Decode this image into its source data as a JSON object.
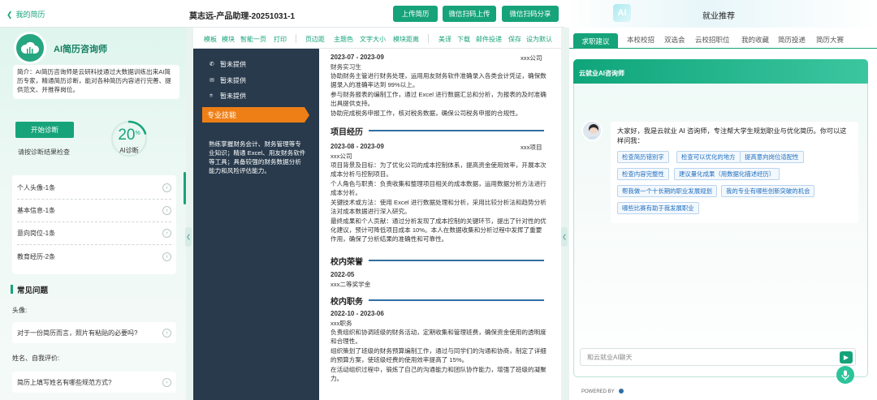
{
  "header": {
    "back_label": "我的简历",
    "doc_title": "莫志远-产品助理-20251031-1",
    "buttons": [
      "上传简历",
      "微信扫码上传",
      "微信扫码分享"
    ],
    "ai_logo": "AI",
    "reco_title": "就业推荐"
  },
  "left": {
    "advisor_title": "AI简历咨询师",
    "intro": "简介：AI简历咨询师是云研科技通过大数据训练出来AI简历专家，精通简历诊断，能对各种简历内容进行完善、提供范文、并推荐岗位。",
    "diagnose_button": "开始诊断",
    "hint": "请按诊断结果检查",
    "score": "20",
    "score_unit": "%",
    "score_label": "AI诊断",
    "score_percent": 20,
    "sections": [
      {
        "label": "个人头像-1条"
      },
      {
        "label": "基本信息-1条"
      },
      {
        "label": "意向岗位-1条"
      },
      {
        "label": "教育经历-2条"
      }
    ],
    "faq_title": "常见问题",
    "faq": [
      {
        "category": "头像:",
        "question": "对于一份简历而言，照片有粘贴的必要吗?"
      },
      {
        "category": "姓名、自我评价:",
        "question": "简历上填写姓名有哪些规范方式?"
      }
    ]
  },
  "toolbar": {
    "group1": [
      "模板",
      "模块",
      "智能一页",
      "打印"
    ],
    "group2": [
      "页边距",
      "主题色",
      "文字大小",
      "模块距离"
    ],
    "group3": [
      "美译",
      "下载",
      "邮件投递",
      "保存",
      "设为默认"
    ]
  },
  "resume": {
    "contact": [
      "暂未提供",
      "暂未提供",
      "暂未提供"
    ],
    "skills_title": "专业技能",
    "skills_text": "熟练掌握财务会计、财务管理等专业知识；精通 Excel、用友财务软件等工具；具备较强的财务数据分析能力和风险评估能力。",
    "job1": {
      "date": "2023-07 - 2023-09",
      "org": "xxx公司",
      "role": "财务实习生",
      "lines": [
        "协助财务主管进行财务处理，运用用友财务软件准确录入各类会计凭证，确保数据录入的准确率达到 99%以上。",
        "参与财务报表的编制工作，通过 Excel 进行数据汇总和分析，为报表的及时准确出具提供支持。",
        "协助完成税务申报工作，核对税务数据，确保公司税务申报的合规性。"
      ]
    },
    "projects_title": "项目经历",
    "project": {
      "date": "2023-08 - 2023-09",
      "org": "xxx项目",
      "company": "xxx公司",
      "lines": [
        "项目背景及目标：为了优化公司的成本控制体系，提高资金使用效率，开展本次成本分析与控制项目。",
        "个人角色与职责：负责收集和整理项目相关的成本数据，运用数据分析方法进行成本分析。",
        "关键技术或方法：使用 Excel 进行数据处理和分析，采用比较分析法和趋势分析法对成本数据进行深入研究。",
        "最终成果和个人贡献：通过分析发现了成本控制的关键环节，提出了针对性的优化建议，预计可降低项目成本 10%。本人在数据收集和分析过程中发挥了重要作用，确保了分析结果的准确性和可靠性。"
      ]
    },
    "honors_title": "校内荣誉",
    "honor": {
      "date": "2022-05",
      "text": "xxx二等奖学金"
    },
    "campus_title": "校内职务",
    "campus": {
      "date": "2022-10 - 2023-06",
      "role": "xxx职务",
      "lines": [
        "负责组织和协调班级的财务活动，定期收集和管理班费，确保资金使用的透明度和合理性。",
        "组织策划了班级的财务预算编制工作，通过与同学们的沟通和协商，制定了详细的预算方案，使班级经费的使用效率提高了 15%。",
        "在活动组织过程中，锻炼了自己的沟通能力和团队协作能力，增强了班级的凝聚力。"
      ]
    }
  },
  "right": {
    "tabs": [
      "求职建议",
      "本校校招",
      "双选会",
      "云校招职位",
      "我的收藏",
      "简历投递",
      "简历大赛"
    ],
    "chat_title": "云就业AI咨询师",
    "greeting": "大家好，我是云就业 AI 咨询师，专注帮大学生规划职业与优化简历。你可以这样问我：",
    "chips": [
      "检查简历错别字",
      "检查可以优化的地方",
      "提高意向岗位适配性",
      "检查内容完整性",
      "建议量化成果（用数据化描述经历）",
      "帮我做一个十长期的职业发展规划",
      "我的专业有哪些创新突破的机会",
      "哪些比赛有助于我发展职业"
    ],
    "input_placeholder": "和云就业AI聊天",
    "powered_by": "POWERED BY"
  },
  "colors": {
    "accent": "#16a37a",
    "resume_sidebar": "#283a4c",
    "skill_tab": "#ee7f16",
    "section_line": "#2f6fa3",
    "chip_text": "#1f6fc0"
  }
}
